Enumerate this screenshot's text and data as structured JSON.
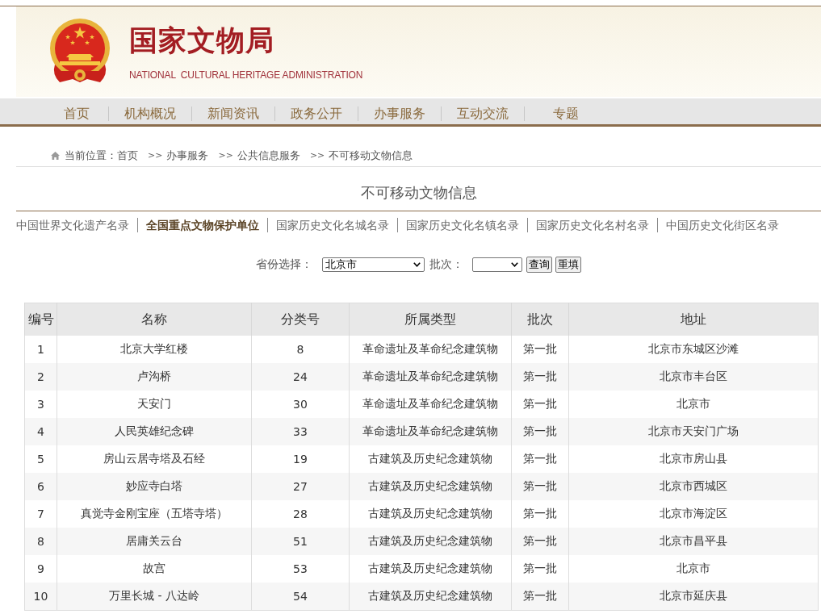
{
  "header": {
    "title": "国家文物局",
    "subtitle": "NATIONAL  CULTURAL HERITAGE ADMINISTRATION"
  },
  "nav": [
    "首页",
    "机构概况",
    "新闻资讯",
    "政务公开",
    "办事服务",
    "互动交流",
    "专题"
  ],
  "breadcrumb": {
    "label": "当前位置：",
    "items": [
      {
        "text": "首页"
      },
      {
        "separator": ">>",
        "text": "办事服务"
      },
      {
        "separator": ">>",
        "text": "公共信息服务"
      },
      {
        "separator": ">>",
        "text": "不可移动文物信息"
      }
    ]
  },
  "page_title": "不可移动文物信息",
  "categories": [
    {
      "label": "中国世界文化遗产名录",
      "selected": false
    },
    {
      "label": "全国重点文物保护单位",
      "selected": true
    },
    {
      "label": "国家历史文化名城名录",
      "selected": false
    },
    {
      "label": "国家历史文化名镇名录",
      "selected": false
    },
    {
      "label": "国家历史文化名村名录",
      "selected": false
    },
    {
      "label": "中国历史文化街区名录",
      "selected": false
    }
  ],
  "filters": {
    "province": {
      "label": "省份选择：",
      "value": "北京市"
    },
    "batch": {
      "label": "批次："
    },
    "buttons": [
      "查询",
      "重填"
    ]
  },
  "table": {
    "columns": [
      "编号",
      "名称",
      "分类号",
      "所属类型",
      "批次",
      "地址"
    ],
    "rows": [
      [
        "1",
        "北京大学红楼",
        "8",
        "革命遗址及革命纪念建筑物",
        "第一批",
        "北京市东城区沙滩"
      ],
      [
        "2",
        "卢沟桥",
        "24",
        "革命遗址及革命纪念建筑物",
        "第一批",
        "北京市丰台区"
      ],
      [
        "3",
        "天安门",
        "30",
        "革命遗址及革命纪念建筑物",
        "第一批",
        "北京市"
      ],
      [
        "4",
        "人民英雄纪念碑",
        "33",
        "革命遗址及革命纪念建筑物",
        "第一批",
        "北京市天安门广场"
      ],
      [
        "5",
        "房山云居寺塔及石经",
        "19",
        "古建筑及历史纪念建筑物",
        "第一批",
        "北京市房山县"
      ],
      [
        "6",
        "妙应寺白塔",
        "27",
        "古建筑及历史纪念建筑物",
        "第一批",
        "北京市西城区"
      ],
      [
        "7",
        "真觉寺金刚宝座（五塔寺塔）",
        "28",
        "古建筑及历史纪念建筑物",
        "第一批",
        "北京市海淀区"
      ],
      [
        "8",
        "居庸关云台",
        "51",
        "古建筑及历史纪念建筑物",
        "第一批",
        "北京市昌平县"
      ],
      [
        "9",
        "故宫",
        "53",
        "古建筑及历史纪念建筑物",
        "第一批",
        "北京市"
      ],
      [
        "10",
        "万里长城 - 八达岭",
        "54",
        "古建筑及历史纪念建筑物",
        "第一批",
        "北京市延庆县"
      ]
    ]
  }
}
